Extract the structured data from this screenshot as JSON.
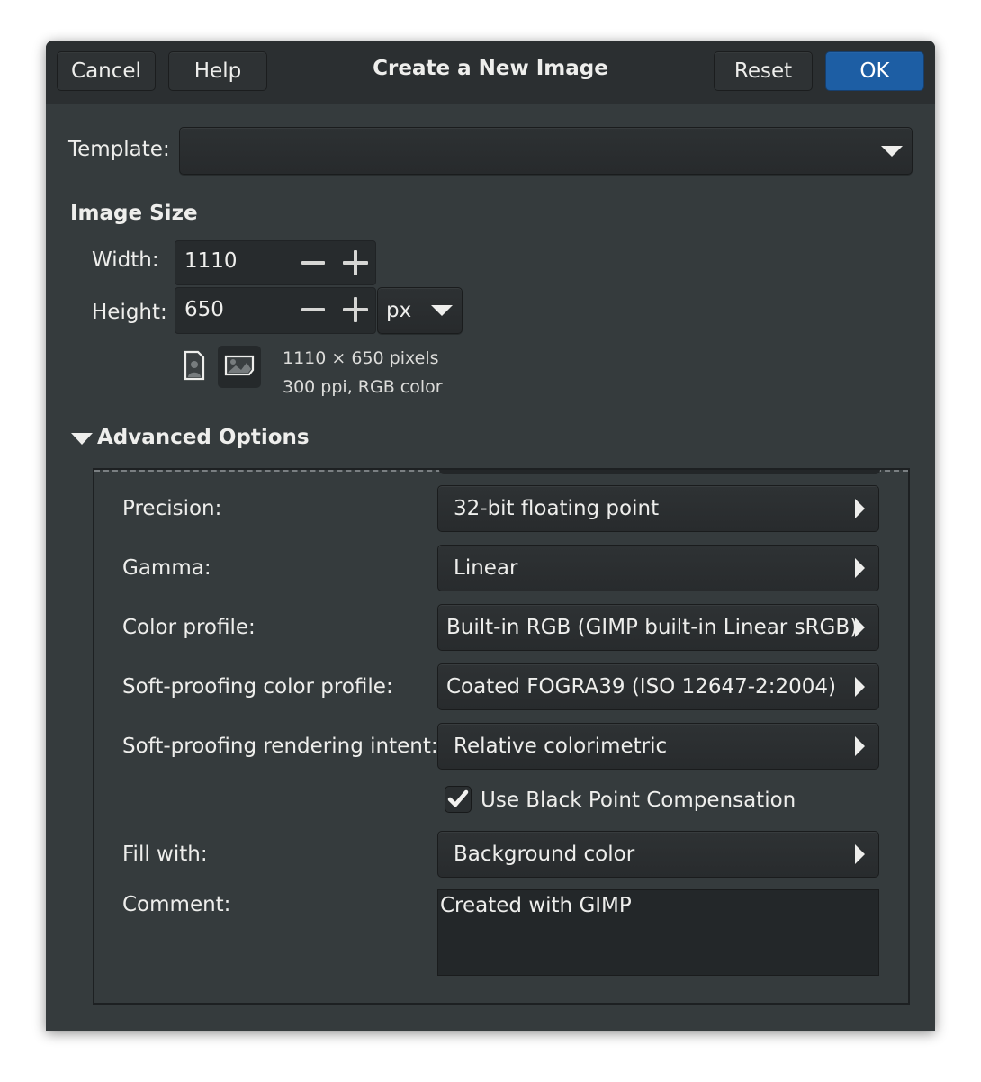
{
  "dialog": {
    "title": "Create a New Image",
    "buttons": {
      "cancel": "Cancel",
      "help": "Help",
      "reset": "Reset",
      "ok": "OK"
    },
    "accent_color": "#1d5ea4"
  },
  "template": {
    "label": "Template:",
    "value": ""
  },
  "image_size": {
    "heading": "Image Size",
    "width_label": "Width:",
    "width_value": "1110",
    "height_label": "Height:",
    "height_value": "650",
    "unit": "px",
    "orientation_icons": [
      "portrait-icon",
      "landscape-icon"
    ],
    "selected_orientation": "landscape",
    "info_line1": "1110 × 650 pixels",
    "info_line2": "300 ppi, RGB color"
  },
  "advanced": {
    "expander_label": "Advanced Options",
    "expanded": true,
    "rows": [
      {
        "label": "Precision:",
        "value": "32-bit floating point"
      },
      {
        "label": "Gamma:",
        "value": "Linear"
      },
      {
        "label": "Color profile:",
        "value": "Built-in RGB (GIMP built-in Linear sRGB)"
      },
      {
        "label": "Soft-proofing color profile:",
        "value": "Coated FOGRA39 (ISO 12647-2:2004)"
      },
      {
        "label": "Soft-proofing rendering intent:",
        "value": "Relative colorimetric"
      }
    ],
    "black_point": {
      "label": "Use Black Point Compensation",
      "checked": true
    },
    "fill": {
      "label": "Fill with:",
      "value": "Background color"
    },
    "comment": {
      "label": "Comment:",
      "value": "Created with GIMP"
    }
  }
}
